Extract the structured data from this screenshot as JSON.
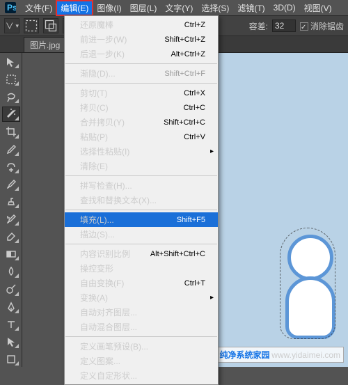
{
  "menubar": {
    "items": [
      {
        "label": "文件(F)"
      },
      {
        "label": "编辑(E)"
      },
      {
        "label": "图像(I)"
      },
      {
        "label": "图层(L)"
      },
      {
        "label": "文字(Y)"
      },
      {
        "label": "选择(S)"
      },
      {
        "label": "滤镜(T)"
      },
      {
        "label": "3D(D)"
      },
      {
        "label": "视图(V)"
      }
    ],
    "active_index": 1
  },
  "optionsbar": {
    "tolerance_label": "容差:",
    "tolerance_value": "32",
    "antialias_label": "消除锯齿"
  },
  "tab": {
    "filename": "图片.jpg"
  },
  "toolbar": {
    "tools": [
      "move-tool",
      "marquee-tool",
      "lasso-tool",
      "magic-wand-tool",
      "crop-tool",
      "eyedropper-tool",
      "spot-heal-tool",
      "brush-tool",
      "clone-stamp-tool",
      "history-brush-tool",
      "eraser-tool",
      "gradient-tool",
      "blur-tool",
      "dodge-tool",
      "pen-tool",
      "type-tool",
      "path-select-tool",
      "shape-tool",
      "hand-tool",
      "zoom-tool"
    ],
    "active": 3
  },
  "menu": {
    "groups": [
      [
        {
          "label": "还原魔棒",
          "shortcut": "Ctrl+Z",
          "enabled": true
        },
        {
          "label": "前进一步(W)",
          "shortcut": "Shift+Ctrl+Z",
          "enabled": true
        },
        {
          "label": "后退一步(K)",
          "shortcut": "Alt+Ctrl+Z",
          "enabled": true
        }
      ],
      [
        {
          "label": "渐隐(D)...",
          "shortcut": "Shift+Ctrl+F",
          "enabled": false
        }
      ],
      [
        {
          "label": "剪切(T)",
          "shortcut": "Ctrl+X",
          "enabled": true
        },
        {
          "label": "拷贝(C)",
          "shortcut": "Ctrl+C",
          "enabled": true
        },
        {
          "label": "合并拷贝(Y)",
          "shortcut": "Shift+Ctrl+C",
          "enabled": true
        },
        {
          "label": "粘贴(P)",
          "shortcut": "Ctrl+V",
          "enabled": true
        },
        {
          "label": "选择性粘贴(I)",
          "shortcut": "",
          "enabled": true,
          "submenu": true
        },
        {
          "label": "清除(E)",
          "shortcut": "",
          "enabled": true
        }
      ],
      [
        {
          "label": "拼写检查(H)...",
          "shortcut": "",
          "enabled": false
        },
        {
          "label": "查找和替换文本(X)...",
          "shortcut": "",
          "enabled": false
        }
      ],
      [
        {
          "label": "填充(L)...",
          "shortcut": "Shift+F5",
          "enabled": true,
          "highlight": true
        },
        {
          "label": "描边(S)...",
          "shortcut": "",
          "enabled": true
        }
      ],
      [
        {
          "label": "内容识别比例",
          "shortcut": "Alt+Shift+Ctrl+C",
          "enabled": true
        },
        {
          "label": "操控变形",
          "shortcut": "",
          "enabled": false
        },
        {
          "label": "自由变换(F)",
          "shortcut": "Ctrl+T",
          "enabled": true
        },
        {
          "label": "变换(A)",
          "shortcut": "",
          "enabled": true,
          "submenu": true
        },
        {
          "label": "自动对齐图层...",
          "shortcut": "",
          "enabled": false
        },
        {
          "label": "自动混合图层...",
          "shortcut": "",
          "enabled": false
        }
      ],
      [
        {
          "label": "定义画笔预设(B)...",
          "shortcut": "",
          "enabled": true
        },
        {
          "label": "定义图案...",
          "shortcut": "",
          "enabled": true
        },
        {
          "label": "定义自定形状...",
          "shortcut": "",
          "enabled": false
        }
      ]
    ]
  },
  "watermark": {
    "brand": "纯净系统家园",
    "url": "www.yidaimei.com"
  }
}
